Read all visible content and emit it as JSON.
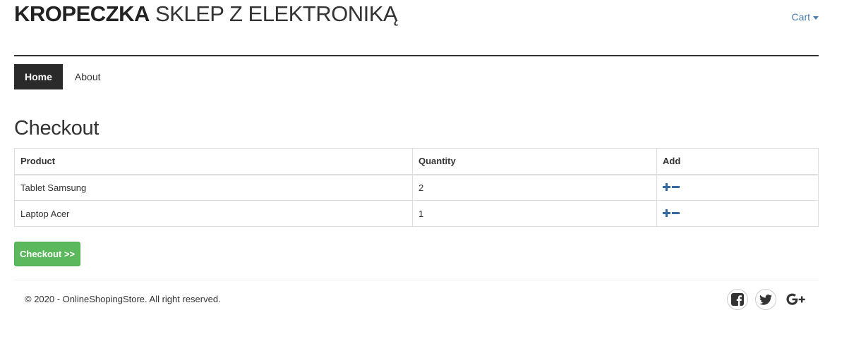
{
  "brand": {
    "bold": "KROPECZKA",
    "light": "SKLEP Z ELEKTRONIKĄ"
  },
  "header": {
    "cart_label": "Cart"
  },
  "nav": {
    "items": [
      {
        "label": "Home",
        "active": true
      },
      {
        "label": "About",
        "active": false
      }
    ]
  },
  "page": {
    "title": "Checkout"
  },
  "table": {
    "headers": [
      "Product",
      "Quantity",
      "Add"
    ],
    "rows": [
      {
        "product": "Tablet Samsung",
        "quantity": "2"
      },
      {
        "product": "Laptop Acer",
        "quantity": "1"
      }
    ]
  },
  "actions": {
    "checkout_label": "Checkout >>"
  },
  "footer": {
    "copyright": "© 2020 - OnlineShopingStore. All right reserved.",
    "social_icons": [
      "facebook-icon",
      "twitter-icon",
      "google-plus-icon"
    ]
  },
  "colors": {
    "accent": "#4a7cae",
    "success": "#5cb85c",
    "nav_active": "#2a2a2a"
  }
}
